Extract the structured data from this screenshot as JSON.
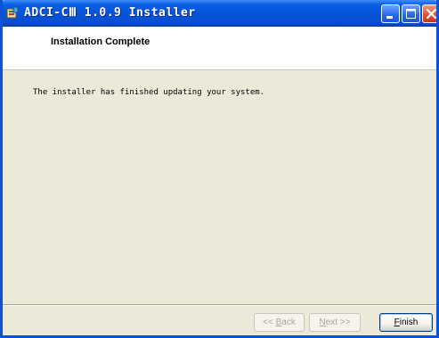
{
  "window": {
    "title": "ADCI-CⅢ 1.0.9 Installer"
  },
  "titlebar_buttons": {
    "minimize": "minimize-icon",
    "maximize": "maximize-icon",
    "close": "close-icon"
  },
  "header": {
    "title": "Installation Complete"
  },
  "body": {
    "message": "The installer has finished updating your system."
  },
  "buttons": {
    "back": {
      "prefix": "<< ",
      "mnemonic": "B",
      "rest": "ack",
      "enabled": false
    },
    "next": {
      "prefix": "",
      "mnemonic": "N",
      "rest": "ext >>",
      "enabled": false
    },
    "finish": {
      "prefix": "",
      "mnemonic": "F",
      "rest": "inish",
      "enabled": true
    }
  },
  "colors": {
    "titlebar": "#0553d9",
    "window_face": "#ece9d8",
    "close_button": "#e3532f"
  }
}
